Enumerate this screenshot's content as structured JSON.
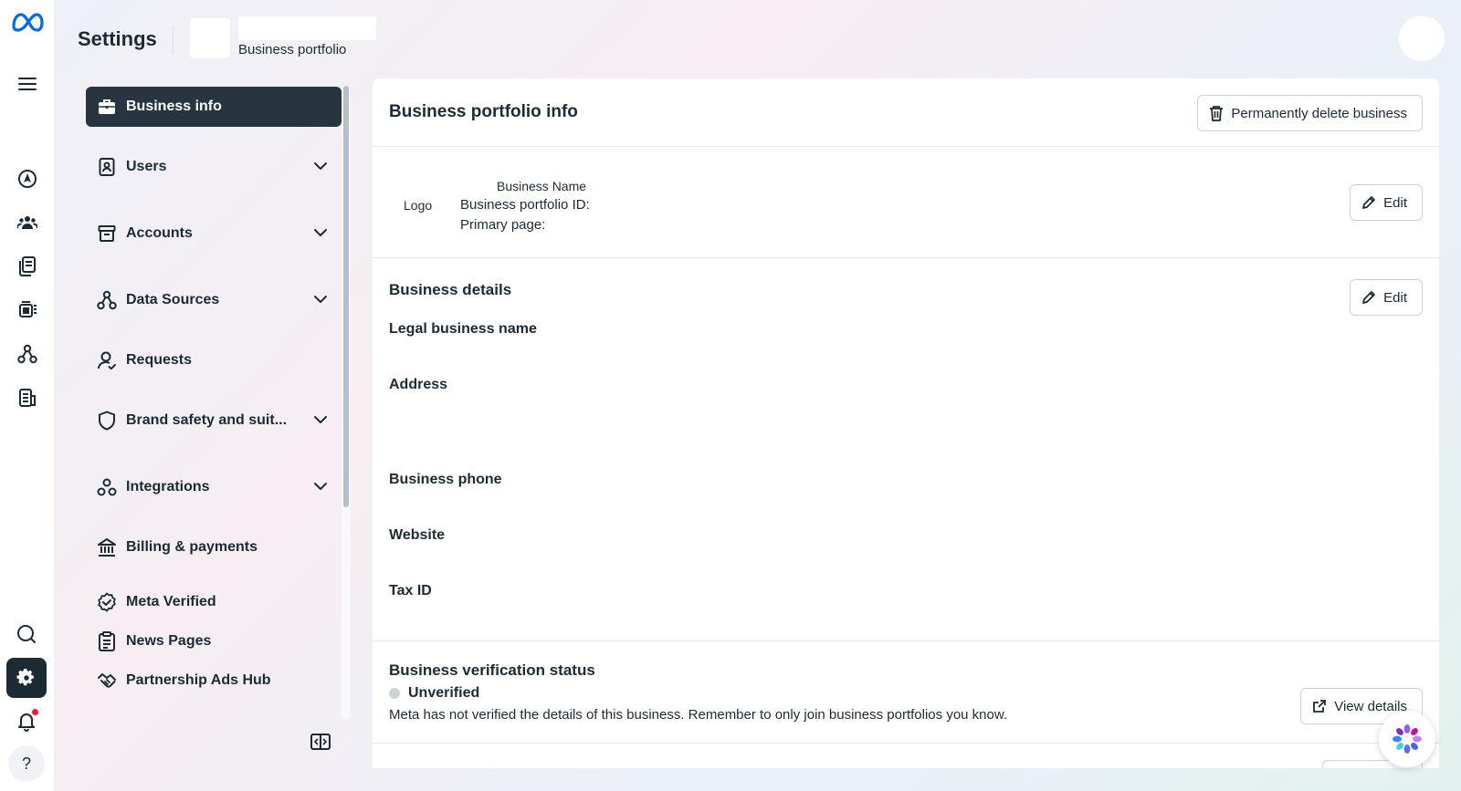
{
  "header": {
    "title": "Settings",
    "portfolio_label": "Business portfolio"
  },
  "sidebar": {
    "items": [
      {
        "label": "Business info",
        "icon": "briefcase-icon",
        "active": true,
        "expandable": false
      },
      {
        "label": "Users",
        "icon": "badge-icon",
        "expandable": true
      },
      {
        "label": "Accounts",
        "icon": "archive-icon",
        "expandable": true
      },
      {
        "label": "Data Sources",
        "icon": "nodes-icon",
        "expandable": true
      },
      {
        "label": "Requests",
        "icon": "person-check-icon",
        "expandable": false
      },
      {
        "label": "Brand safety and suit...",
        "icon": "shield-icon",
        "expandable": true
      },
      {
        "label": "Integrations",
        "icon": "integrations-icon",
        "expandable": true
      },
      {
        "label": "Billing & payments",
        "icon": "bank-icon",
        "expandable": false
      },
      {
        "label": "Meta Verified",
        "icon": "verified-badge-icon",
        "expandable": false
      },
      {
        "label": "News Pages",
        "icon": "clipboard-icon",
        "expandable": false
      },
      {
        "label": "Partnership Ads Hub",
        "icon": "handshake-icon",
        "expandable": false
      }
    ]
  },
  "main": {
    "portfolio_info": {
      "title": "Business portfolio info",
      "delete_button": "Permanently delete business",
      "logo_label": "Logo",
      "business_name": "Business Name",
      "portfolio_id_label": "Business portfolio ID:",
      "primary_page_label": "Primary page:",
      "edit_button": "Edit"
    },
    "business_details": {
      "title": "Business details",
      "edit_button": "Edit",
      "fields": [
        "Legal business name",
        "Address",
        "Business phone",
        "Website",
        "Tax ID"
      ]
    },
    "verification": {
      "title": "Business verification status",
      "status": "Unverified",
      "description": "Meta has not verified the details of this business. Remember to only join business portfolios you know.",
      "button": "View details"
    }
  },
  "colors": {
    "active_nav_bg": "#283541",
    "rail_active_bg": "#1c2b33",
    "notification_dot": "#e41e3f",
    "meta_blue": "#0668e1",
    "status_unverified": "#cfd3d8"
  }
}
